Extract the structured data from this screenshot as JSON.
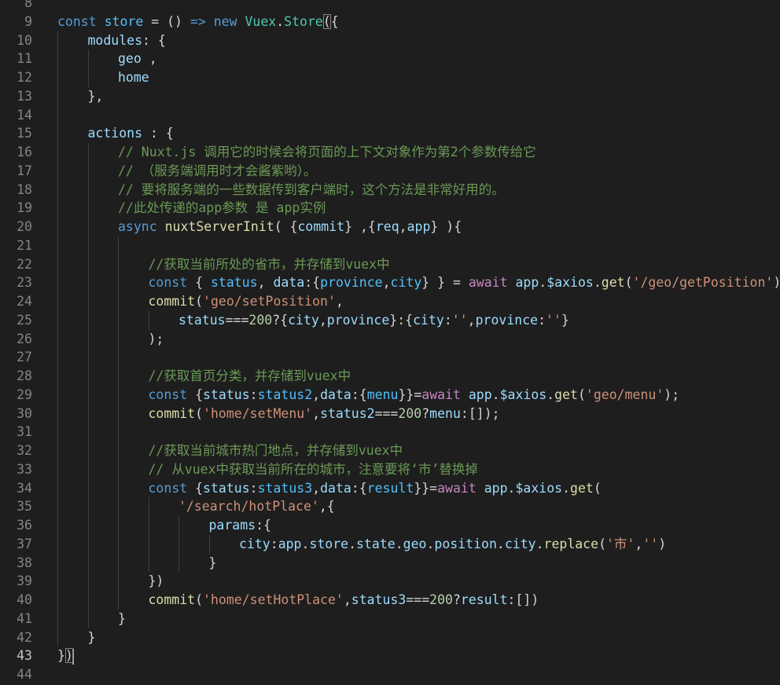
{
  "colors": {
    "background": "#1e1e1e",
    "line_number": "#858585",
    "line_number_active": "#c6c6c6",
    "indent_guide": "#404040",
    "k": "#569cd6",
    "c": "#4fc1ff",
    "v": "#9cdcfe",
    "f": "#dcdcaa",
    "s": "#ce9178",
    "m": "#6a9955",
    "n": "#b5cea8",
    "p": "#c586c0",
    "t": "#4ec9b0",
    "o": "#d4d4d4"
  },
  "editor": {
    "active_line": 43,
    "lines": [
      {
        "n": "8",
        "indent": 0,
        "tokens": []
      },
      {
        "n": "9",
        "indent": 0,
        "tokens": [
          [
            "k",
            "const"
          ],
          [
            "o",
            " "
          ],
          [
            "c",
            "store"
          ],
          [
            "o",
            " = () "
          ],
          [
            "k",
            "=>"
          ],
          [
            "o",
            " "
          ],
          [
            "k",
            "new"
          ],
          [
            "o",
            " "
          ],
          [
            "t",
            "Vuex"
          ],
          [
            "o",
            "."
          ],
          [
            "t",
            "Store"
          ],
          [
            "o",
            "("
          ],
          [
            "o",
            "{"
          ]
        ]
      },
      {
        "n": "10",
        "indent": 1,
        "tokens": [
          [
            "v",
            "modules"
          ],
          [
            "o",
            ": {"
          ]
        ]
      },
      {
        "n": "11",
        "indent": 2,
        "tokens": [
          [
            "v",
            "geo"
          ],
          [
            "o",
            " ,"
          ]
        ]
      },
      {
        "n": "12",
        "indent": 2,
        "tokens": [
          [
            "v",
            "home"
          ]
        ]
      },
      {
        "n": "13",
        "indent": 1,
        "tokens": [
          [
            "o",
            "},"
          ]
        ]
      },
      {
        "n": "14",
        "indent": 1,
        "tokens": []
      },
      {
        "n": "15",
        "indent": 1,
        "tokens": [
          [
            "v",
            "actions"
          ],
          [
            "o",
            " : {"
          ]
        ]
      },
      {
        "n": "16",
        "indent": 2,
        "tokens": [
          [
            "m",
            "// Nuxt.js 调用它的时候会将页面的上下文对象作为第2个参数传给它"
          ]
        ]
      },
      {
        "n": "17",
        "indent": 2,
        "tokens": [
          [
            "m",
            "// （服务端调用时才会酱紫哟）。"
          ]
        ]
      },
      {
        "n": "18",
        "indent": 2,
        "tokens": [
          [
            "m",
            "// 要将服务端的一些数据传到客户端时，这个方法是非常好用的。"
          ]
        ]
      },
      {
        "n": "19",
        "indent": 2,
        "tokens": [
          [
            "m",
            "//此处传递的app参数 是 app实例"
          ]
        ]
      },
      {
        "n": "20",
        "indent": 2,
        "tokens": [
          [
            "k",
            "async"
          ],
          [
            "o",
            " "
          ],
          [
            "f",
            "nuxtServerInit"
          ],
          [
            "o",
            "( {"
          ],
          [
            "v",
            "commit"
          ],
          [
            "o",
            "} ,{"
          ],
          [
            "v",
            "req"
          ],
          [
            "o",
            ","
          ],
          [
            "v",
            "app"
          ],
          [
            "o",
            "} ){"
          ]
        ]
      },
      {
        "n": "21",
        "indent": 3,
        "tokens": []
      },
      {
        "n": "22",
        "indent": 3,
        "tokens": [
          [
            "m",
            "//获取当前所处的省市，并存储到vuex中"
          ]
        ]
      },
      {
        "n": "23",
        "indent": 3,
        "tokens": [
          [
            "k",
            "const"
          ],
          [
            "o",
            " { "
          ],
          [
            "c",
            "status"
          ],
          [
            "o",
            ", "
          ],
          [
            "v",
            "data"
          ],
          [
            "o",
            ":{"
          ],
          [
            "c",
            "province"
          ],
          [
            "o",
            ","
          ],
          [
            "c",
            "city"
          ],
          [
            "o",
            "} } = "
          ],
          [
            "p",
            "await"
          ],
          [
            "o",
            " "
          ],
          [
            "v",
            "app"
          ],
          [
            "o",
            "."
          ],
          [
            "v",
            "$axios"
          ],
          [
            "o",
            "."
          ],
          [
            "f",
            "get"
          ],
          [
            "o",
            "("
          ],
          [
            "s",
            "'/geo/getPosition'"
          ],
          [
            "o",
            ");"
          ]
        ]
      },
      {
        "n": "24",
        "indent": 3,
        "tokens": [
          [
            "f",
            "commit"
          ],
          [
            "o",
            "("
          ],
          [
            "s",
            "'geo/setPosition'"
          ],
          [
            "o",
            ","
          ]
        ]
      },
      {
        "n": "25",
        "indent": 4,
        "tokens": [
          [
            "v",
            "status"
          ],
          [
            "o",
            "==="
          ],
          [
            "n",
            "200"
          ],
          [
            "o",
            "?{"
          ],
          [
            "v",
            "city"
          ],
          [
            "o",
            ","
          ],
          [
            "v",
            "province"
          ],
          [
            "o",
            "}:{"
          ],
          [
            "v",
            "city"
          ],
          [
            "o",
            ":"
          ],
          [
            "s",
            "''"
          ],
          [
            "o",
            ","
          ],
          [
            "v",
            "province"
          ],
          [
            "o",
            ":"
          ],
          [
            "s",
            "''"
          ],
          [
            "o",
            "}"
          ]
        ]
      },
      {
        "n": "26",
        "indent": 3,
        "tokens": [
          [
            "o",
            ");"
          ]
        ]
      },
      {
        "n": "27",
        "indent": 3,
        "tokens": []
      },
      {
        "n": "28",
        "indent": 3,
        "tokens": [
          [
            "m",
            "//获取首页分类，并存储到vuex中"
          ]
        ]
      },
      {
        "n": "29",
        "indent": 3,
        "tokens": [
          [
            "k",
            "const"
          ],
          [
            "o",
            " {"
          ],
          [
            "v",
            "status"
          ],
          [
            "o",
            ":"
          ],
          [
            "c",
            "status2"
          ],
          [
            "o",
            ","
          ],
          [
            "v",
            "data"
          ],
          [
            "o",
            ":{"
          ],
          [
            "c",
            "menu"
          ],
          [
            "o",
            "}}="
          ],
          [
            "p",
            "await"
          ],
          [
            "o",
            " "
          ],
          [
            "v",
            "app"
          ],
          [
            "o",
            "."
          ],
          [
            "v",
            "$axios"
          ],
          [
            "o",
            "."
          ],
          [
            "f",
            "get"
          ],
          [
            "o",
            "("
          ],
          [
            "s",
            "'geo/menu'"
          ],
          [
            "o",
            ");"
          ]
        ]
      },
      {
        "n": "30",
        "indent": 3,
        "tokens": [
          [
            "f",
            "commit"
          ],
          [
            "o",
            "("
          ],
          [
            "s",
            "'home/setMenu'"
          ],
          [
            "o",
            ","
          ],
          [
            "v",
            "status2"
          ],
          [
            "o",
            "==="
          ],
          [
            "n",
            "200"
          ],
          [
            "o",
            "?"
          ],
          [
            "v",
            "menu"
          ],
          [
            "o",
            ":[]);"
          ]
        ]
      },
      {
        "n": "31",
        "indent": 3,
        "tokens": []
      },
      {
        "n": "32",
        "indent": 3,
        "tokens": [
          [
            "m",
            "//获取当前城市热门地点，并存储到vuex中"
          ]
        ]
      },
      {
        "n": "33",
        "indent": 3,
        "tokens": [
          [
            "m",
            "// 从vuex中获取当前所在的城市，注意要将‘市’替换掉"
          ]
        ]
      },
      {
        "n": "34",
        "indent": 3,
        "tokens": [
          [
            "k",
            "const"
          ],
          [
            "o",
            " {"
          ],
          [
            "v",
            "status"
          ],
          [
            "o",
            ":"
          ],
          [
            "c",
            "status3"
          ],
          [
            "o",
            ","
          ],
          [
            "v",
            "data"
          ],
          [
            "o",
            ":{"
          ],
          [
            "c",
            "result"
          ],
          [
            "o",
            "}}="
          ],
          [
            "p",
            "await"
          ],
          [
            "o",
            " "
          ],
          [
            "v",
            "app"
          ],
          [
            "o",
            "."
          ],
          [
            "v",
            "$axios"
          ],
          [
            "o",
            "."
          ],
          [
            "f",
            "get"
          ],
          [
            "o",
            "("
          ]
        ]
      },
      {
        "n": "35",
        "indent": 4,
        "tokens": [
          [
            "s",
            "'/search/hotPlace'"
          ],
          [
            "o",
            ",{"
          ]
        ]
      },
      {
        "n": "36",
        "indent": 5,
        "tokens": [
          [
            "v",
            "params"
          ],
          [
            "o",
            ":{"
          ]
        ]
      },
      {
        "n": "37",
        "indent": 6,
        "tokens": [
          [
            "v",
            "city"
          ],
          [
            "o",
            ":"
          ],
          [
            "v",
            "app"
          ],
          [
            "o",
            "."
          ],
          [
            "v",
            "store"
          ],
          [
            "o",
            "."
          ],
          [
            "v",
            "state"
          ],
          [
            "o",
            "."
          ],
          [
            "v",
            "geo"
          ],
          [
            "o",
            "."
          ],
          [
            "v",
            "position"
          ],
          [
            "o",
            "."
          ],
          [
            "v",
            "city"
          ],
          [
            "o",
            "."
          ],
          [
            "f",
            "replace"
          ],
          [
            "o",
            "("
          ],
          [
            "s",
            "'市'"
          ],
          [
            "o",
            ","
          ],
          [
            "s",
            "''"
          ],
          [
            "o",
            ")"
          ]
        ]
      },
      {
        "n": "38",
        "indent": 5,
        "tokens": [
          [
            "o",
            "}"
          ]
        ]
      },
      {
        "n": "39",
        "indent": 3,
        "tokens": [
          [
            "o",
            "})"
          ]
        ]
      },
      {
        "n": "40",
        "indent": 3,
        "tokens": [
          [
            "f",
            "commit"
          ],
          [
            "o",
            "("
          ],
          [
            "s",
            "'home/setHotPlace'"
          ],
          [
            "o",
            ","
          ],
          [
            "v",
            "status3"
          ],
          [
            "o",
            "==="
          ],
          [
            "n",
            "200"
          ],
          [
            "o",
            "?"
          ],
          [
            "v",
            "result"
          ],
          [
            "o",
            ":[])"
          ]
        ]
      },
      {
        "n": "41",
        "indent": 2,
        "tokens": [
          [
            "o",
            "}"
          ]
        ]
      },
      {
        "n": "42",
        "indent": 1,
        "tokens": [
          [
            "o",
            "}"
          ]
        ]
      },
      {
        "n": "43",
        "indent": 0,
        "tokens": [
          [
            "o",
            "}"
          ],
          [
            "o",
            ")"
          ]
        ]
      },
      {
        "n": "44",
        "indent": 0,
        "tokens": []
      }
    ]
  }
}
